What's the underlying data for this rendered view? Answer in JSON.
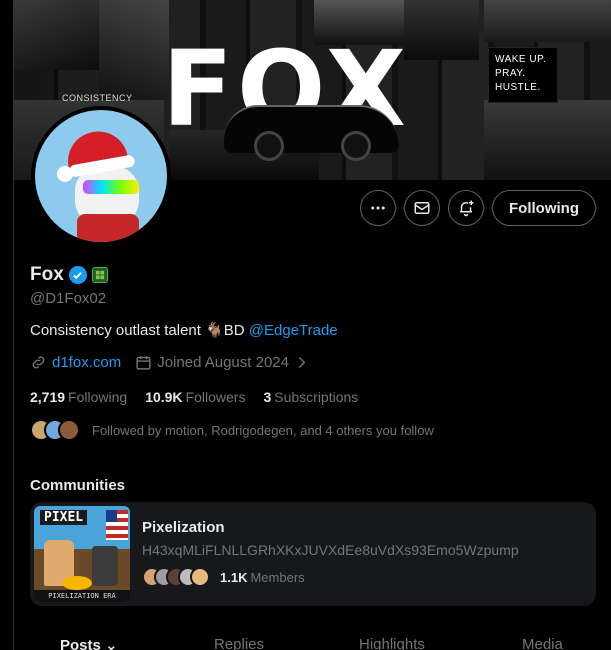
{
  "banner": {
    "title": "FOX",
    "consistency_label": "CONSISTENCY",
    "motto": [
      "WAKE UP.",
      "PRAY.",
      "HUSTLE."
    ]
  },
  "actions": {
    "more": "more-icon",
    "message": "mail-icon",
    "notify": "bell-plus-icon",
    "follow_label": "Following"
  },
  "profile": {
    "name": "Fox",
    "handle": "@D1Fox02",
    "bio_text": "Consistency outlast talent 🐐BD ",
    "bio_link": "@EdgeTrade",
    "website": "d1fox.com",
    "joined": "Joined August 2024"
  },
  "stats": {
    "following_count": "2,719",
    "following_label": "Following",
    "followers_count": "10.9K",
    "followers_label": "Followers",
    "subs_count": "3",
    "subs_label": "Subscriptions"
  },
  "followed_by": "Followed by motion, Rodrigodegen, and 4 others you follow",
  "communities": {
    "title": "Communities",
    "card": {
      "image_title": "PIXEL",
      "image_caption": "PIXELIZATION ERA",
      "name": "Pixelization",
      "description": "H43xqMLiFLNLLGRhXKxJUVXdEe8uVdXs93Emo5Wzpump",
      "members_count": "1.1K",
      "members_label": "Members"
    }
  },
  "tabs": [
    "Posts",
    "Replies",
    "Highlights",
    "Media"
  ],
  "colors": {
    "accent": "#1d9bf0",
    "muted": "#71767b",
    "text": "#e7e9ea",
    "card": "#16181c"
  }
}
